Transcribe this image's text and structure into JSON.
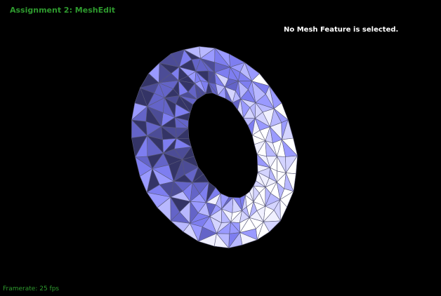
{
  "app": {
    "title": "Assignment 2: MeshEdit"
  },
  "status": {
    "selection_message": "No Mesh Feature is selected.",
    "framerate_label": "Framerate: 25 fps"
  },
  "viewport": {
    "background_color": "#000000",
    "title_color": "#2e9a2e",
    "mesh_edge_color": "#5a5a7a",
    "mesh_palette": [
      "#ffffff",
      "#f0f0ff",
      "#d4d4ff",
      "#b8b8ff",
      "#9a9aff",
      "#7e7ef0",
      "#6464c8",
      "#4c4c96",
      "#343466"
    ]
  }
}
